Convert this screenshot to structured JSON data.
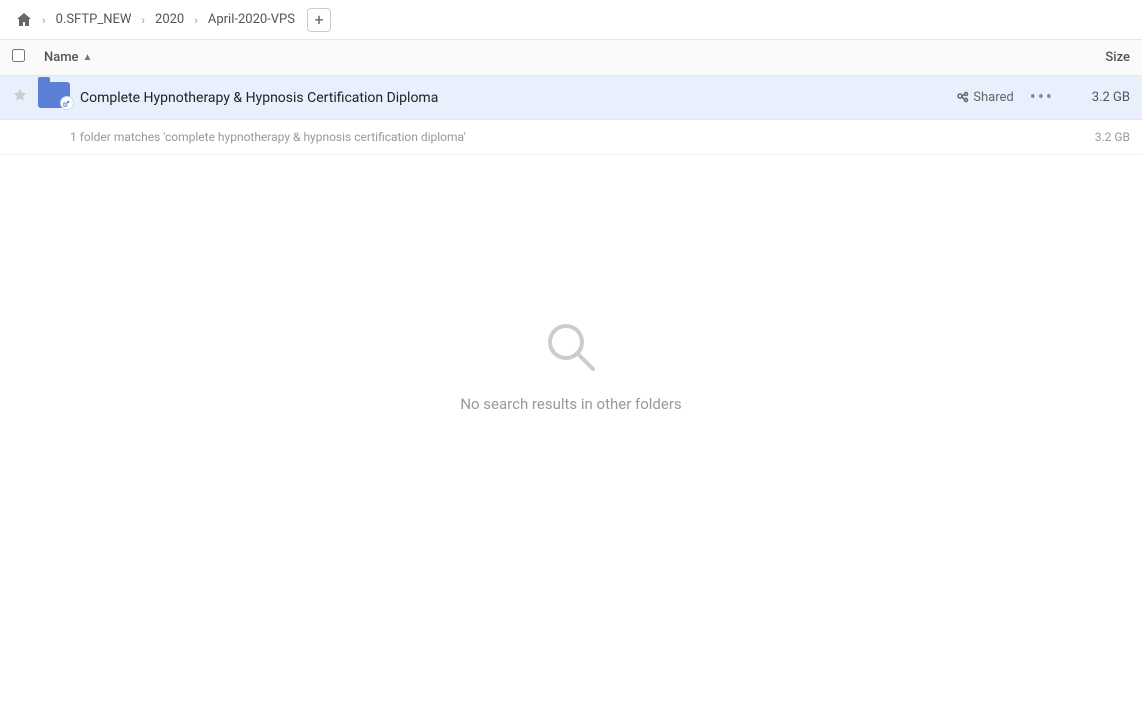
{
  "breadcrumb": {
    "home_label": "Home",
    "items": [
      {
        "label": "0.SFTP_NEW"
      },
      {
        "label": "2020"
      },
      {
        "label": "April-2020-VPS"
      }
    ],
    "add_label": "+"
  },
  "columns": {
    "name_label": "Name",
    "sort_arrow": "▲",
    "size_label": "Size"
  },
  "file_row": {
    "folder_name": "Complete Hypnotherapy & Hypnosis Certification Diploma",
    "shared_label": "Shared",
    "size": "3.2 GB",
    "more_icon": "•••"
  },
  "summary": {
    "text": "1 folder matches 'complete hypnotherapy & hypnosis certification diploma'",
    "size": "3.2 GB"
  },
  "empty_state": {
    "message": "No search results in other folders"
  }
}
